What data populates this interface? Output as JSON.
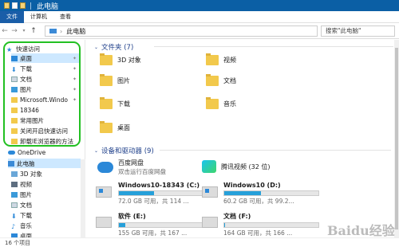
{
  "titlebar": {
    "title": "此电脑"
  },
  "ribbon": {
    "tabs": [
      "文件",
      "计算机",
      "查看"
    ]
  },
  "address": {
    "path": "此电脑",
    "search_placeholder": "搜索\"此电脑\""
  },
  "nav": {
    "quick_access": "快速访问",
    "pinned": [
      "桌面",
      "下载",
      "文档",
      "图片",
      "Microsoft.Windo",
      "18346",
      "常用图片",
      "关闭开启快速访问",
      "卸载IE浏览器的方法"
    ],
    "onedrive": "OneDrive",
    "this_pc": "此电脑",
    "pc_items": [
      "3D 对象",
      "视频",
      "图片",
      "文档",
      "下载",
      "音乐",
      "桌面"
    ]
  },
  "main": {
    "folders_header": "文件夹 (7)",
    "folders": [
      "3D 对象",
      "视频",
      "图片",
      "文档",
      "下载",
      "音乐",
      "桌面"
    ],
    "devices_header": "设备和驱动器 (9)",
    "devices": [
      {
        "name": "百度网盘",
        "sub": "双击运行百度网盘"
      },
      {
        "name": "腾讯视频 (32 位)",
        "sub": ""
      }
    ],
    "drives": [
      {
        "name": "Windows10-18343 (C:)",
        "info": "72.0 GB 可用，共 114 ...",
        "used": 0.37
      },
      {
        "name": "Windows10 (D:)",
        "info": "60.2 GB 可用，共 99.2...",
        "used": 0.39
      },
      {
        "name": "软件 (E:)",
        "info": "155 GB 可用，共 167 ...",
        "used": 0.07
      },
      {
        "name": "文档 (F:)",
        "info": "164 GB 可用，共 166 ...",
        "used": 0.01
      }
    ]
  },
  "status": {
    "count": "16 个项目"
  },
  "watermark": "Baidu经验",
  "colors": {
    "accent": "#0b5fa5",
    "highlight": "#22c022",
    "drive_fill": "#26a0da"
  }
}
